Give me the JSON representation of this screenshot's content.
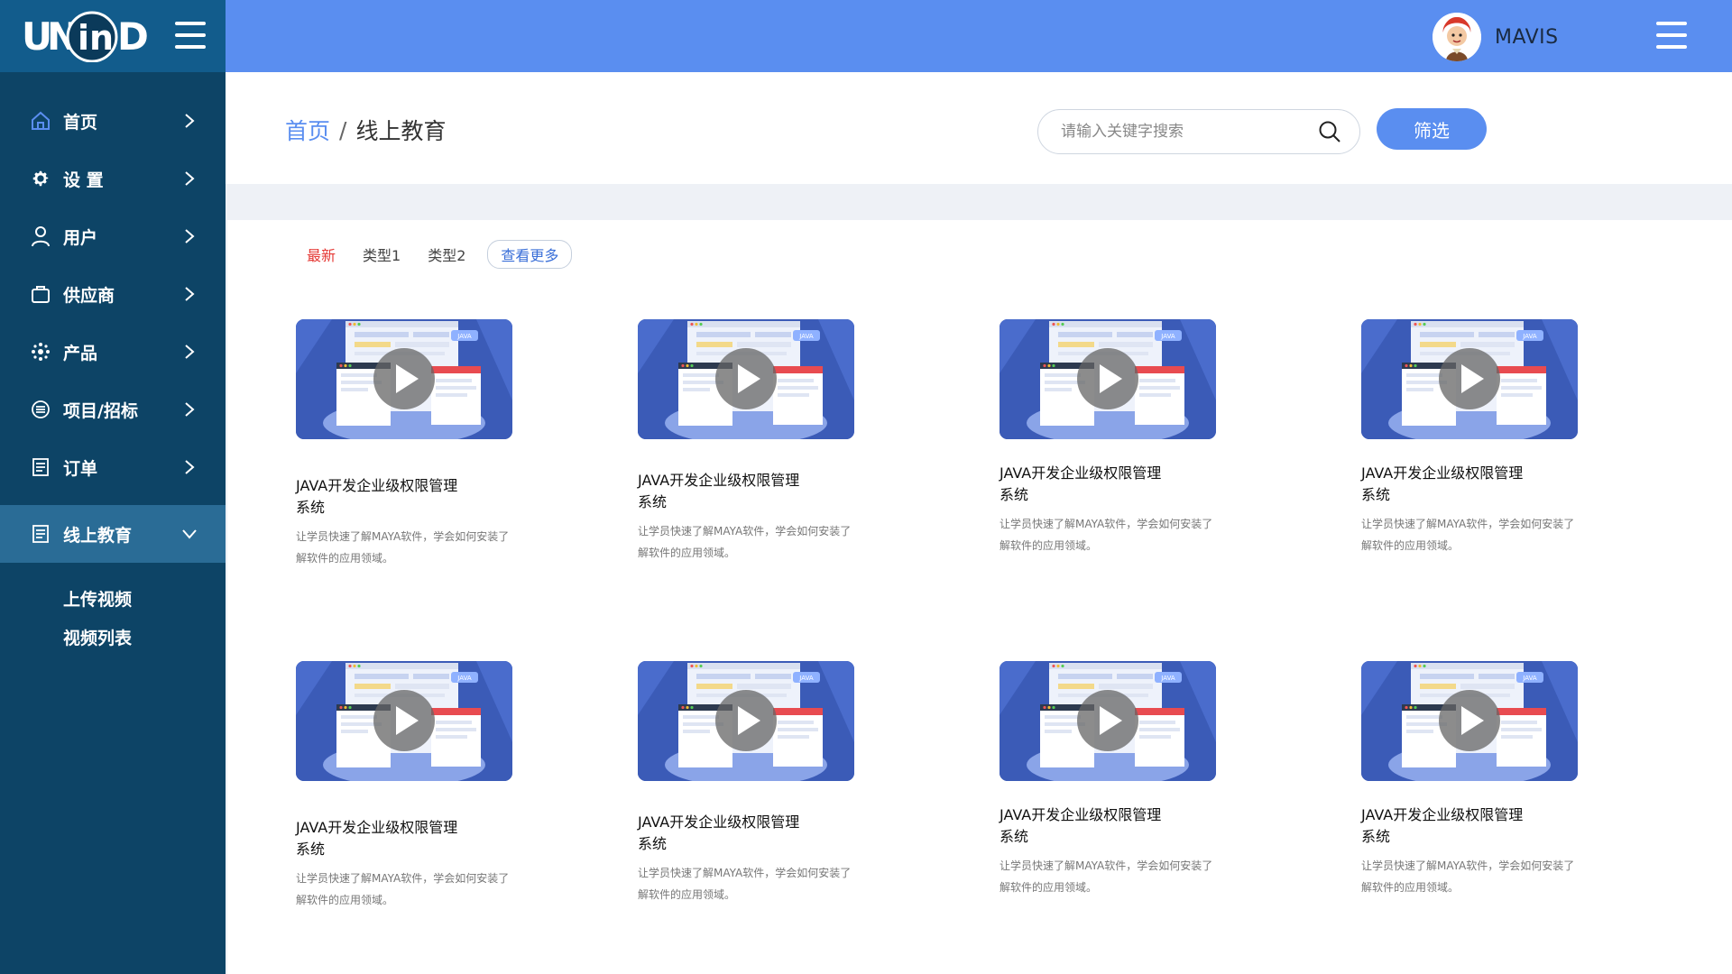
{
  "brand": {
    "logo_text": "UNIND"
  },
  "colors": {
    "sidebar": "#0d4466",
    "logo_bar": "#125c8c",
    "topbar": "#5a8ef0",
    "accent": "#5a8ef0",
    "active_tab": "#e53935"
  },
  "sidebar": {
    "items": [
      {
        "label": "首页",
        "icon": "home-icon"
      },
      {
        "label": "设 置",
        "icon": "gear-icon"
      },
      {
        "label": "用户",
        "icon": "user-icon"
      },
      {
        "label": "供应商",
        "icon": "bag-icon"
      },
      {
        "label": "产品",
        "icon": "cog-cluster-icon"
      },
      {
        "label": "项目/招标",
        "icon": "list-circle-icon"
      },
      {
        "label": "订单",
        "icon": "clipboard-icon"
      },
      {
        "label": "线上教育",
        "icon": "clipboard-icon",
        "active": true
      }
    ],
    "sub_items": [
      "上传视频",
      "视频列表"
    ]
  },
  "topbar": {
    "user_name": "MAVIS"
  },
  "breadcrumb": {
    "home": "首页",
    "separator": "/",
    "current": "线上教育"
  },
  "search": {
    "placeholder": "请输入关键字搜索"
  },
  "filter_button": "筛选",
  "tabs": [
    "最新",
    "类型1",
    "类型2",
    "查看更多"
  ],
  "cards": [
    {
      "title": "JAVA开发企业级权限管理系统",
      "desc": "让学员快速了解MAYA软件，学会如何安装了解软件的应用领域。",
      "badge": "JAVA"
    },
    {
      "title": "JAVA开发企业级权限管理系统",
      "desc": "让学员快速了解MAYA软件，学会如何安装了解软件的应用领域。",
      "badge": "JAVA"
    },
    {
      "title": "JAVA开发企业级权限管理系统",
      "desc": "让学员快速了解MAYA软件，学会如何安装了解软件的应用领域。",
      "badge": "JAVA"
    },
    {
      "title": "JAVA开发企业级权限管理系统",
      "desc": "让学员快速了解MAYA软件，学会如何安装了解软件的应用领域。",
      "badge": "JAVA"
    },
    {
      "title": "JAVA开发企业级权限管理系统",
      "desc": "让学员快速了解MAYA软件，学会如何安装了解软件的应用领域。",
      "badge": "JAVA"
    },
    {
      "title": "JAVA开发企业级权限管理系统",
      "desc": "让学员快速了解MAYA软件，学会如何安装了解软件的应用领域。",
      "badge": "JAVA"
    },
    {
      "title": "JAVA开发企业级权限管理系统",
      "desc": "让学员快速了解MAYA软件，学会如何安装了解软件的应用领域。",
      "badge": "JAVA"
    },
    {
      "title": "JAVA开发企业级权限管理系统",
      "desc": "让学员快速了解MAYA软件，学会如何安装了解软件的应用领域。",
      "badge": "JAVA"
    }
  ]
}
